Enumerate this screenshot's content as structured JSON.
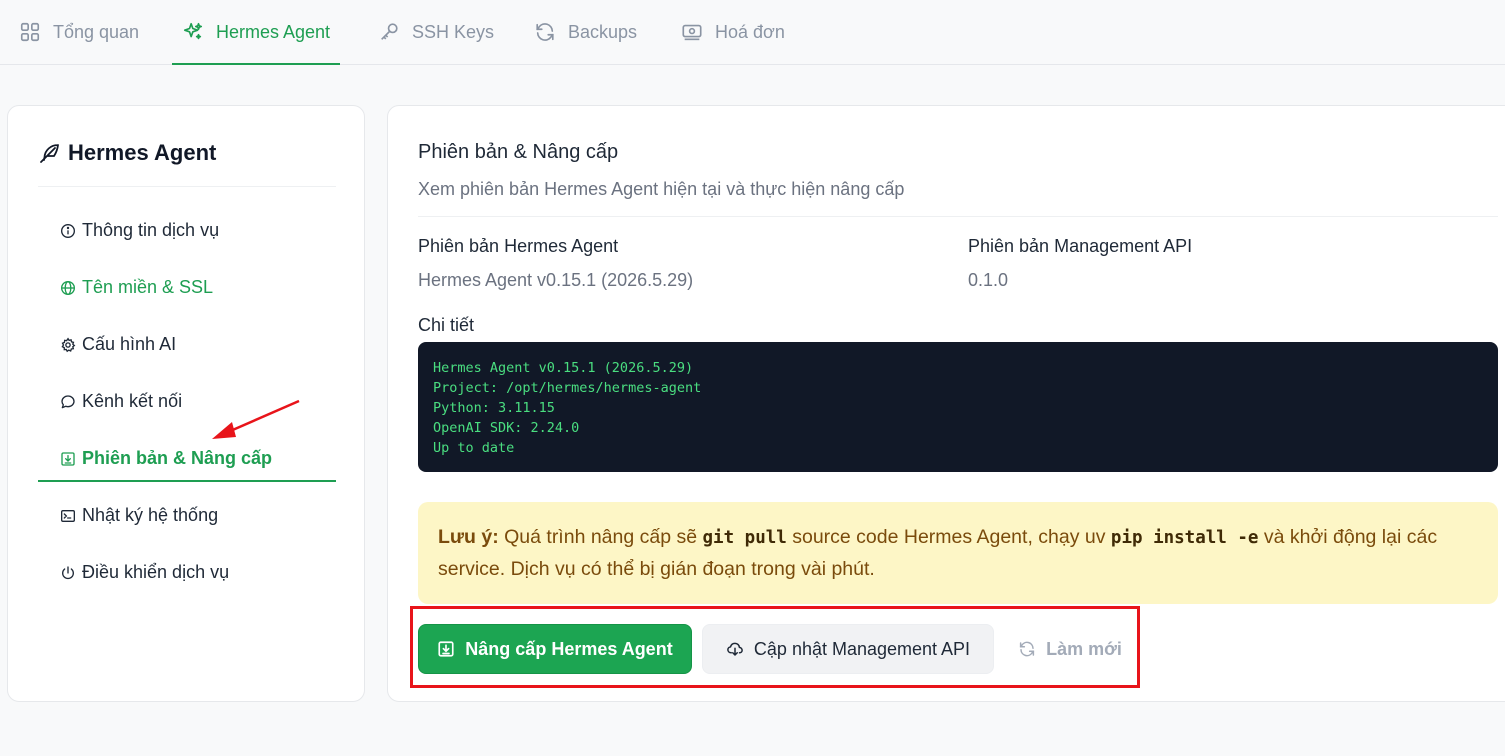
{
  "tabs": [
    {
      "label": "Tổng quan",
      "icon": "grid-icon"
    },
    {
      "label": "Hermes Agent",
      "icon": "sparkles-icon"
    },
    {
      "label": "SSH Keys",
      "icon": "key-icon"
    },
    {
      "label": "Backups",
      "icon": "refresh-icon"
    },
    {
      "label": "Hoá đơn",
      "icon": "bill-icon"
    }
  ],
  "sidebar": {
    "title": "Hermes Agent",
    "items": [
      {
        "label": "Thông tin dịch vụ",
        "icon": "info-icon"
      },
      {
        "label": "Tên miền & SSL",
        "icon": "globe-icon"
      },
      {
        "label": "Cấu hình AI",
        "icon": "gear-icon"
      },
      {
        "label": "Kênh kết nối",
        "icon": "chat-bubble-icon"
      },
      {
        "label": "Phiên bản & Nâng cấp",
        "icon": "upgrade-icon"
      },
      {
        "label": "Nhật ký hệ thống",
        "icon": "terminal-icon"
      },
      {
        "label": "Điều khiển dịch vụ",
        "icon": "power-icon"
      }
    ]
  },
  "main": {
    "title": "Phiên bản & Nâng cấp",
    "description": "Xem phiên bản Hermes Agent hiện tại và thực hiện nâng cấp",
    "agent_version_label": "Phiên bản Hermes Agent",
    "agent_version_value": "Hermes Agent v0.15.1 (2026.5.29)",
    "api_version_label": "Phiên bản Management API",
    "api_version_value": "0.1.0",
    "details_label": "Chi tiết",
    "details_lines": [
      "Hermes Agent v0.15.1 (2026.5.29)",
      "Project: /opt/hermes/hermes-agent",
      "Python: 3.11.15",
      "OpenAI SDK: 2.24.0",
      "Up to date"
    ],
    "note": {
      "prefix": "Lưu ý:",
      "text1": " Quá trình nâng cấp sẽ ",
      "code1": "git pull",
      "text2": " source code Hermes Agent, chạy ",
      "code2a": "uv",
      "code2b": "pip install -e",
      "text3": " và khởi động lại các service. Dịch vụ có thể bị gián đoạn trong vài phút."
    },
    "buttons": {
      "upgrade_agent": "Nâng cấp Hermes Agent",
      "update_api": "Cập nhật Management API",
      "refresh": "Làm mới"
    }
  },
  "colors": {
    "accent": "#1e9e52",
    "code_bg": "#111827",
    "code_text": "#4ade80",
    "note_bg": "#fdf6c6",
    "annotation": "#e8141a"
  }
}
